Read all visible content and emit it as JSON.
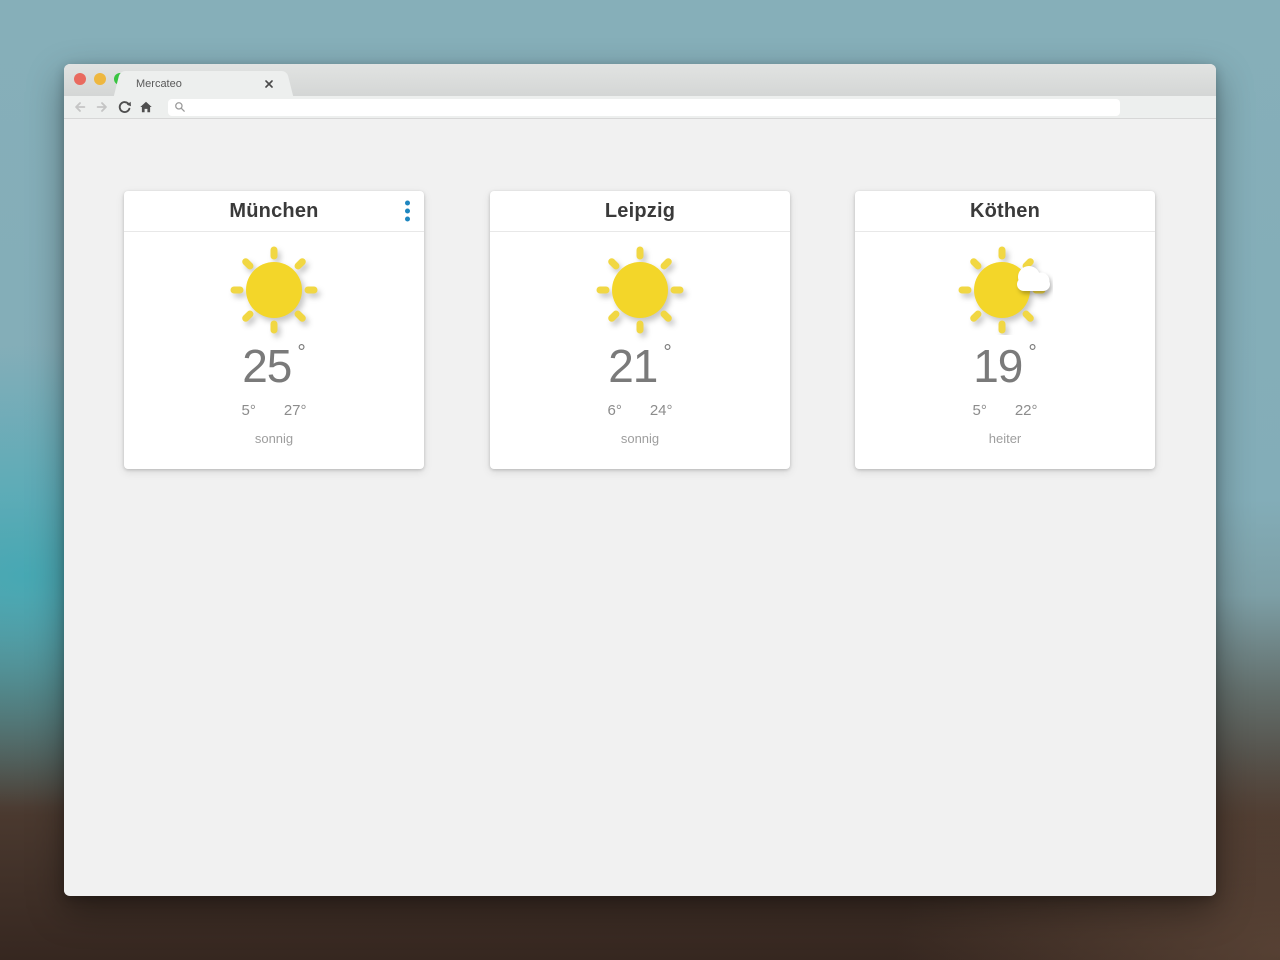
{
  "window": {
    "tab_title": "Mercateo"
  },
  "toolbar": {
    "url_value": "",
    "icons": [
      "back-icon",
      "forward-icon",
      "reload-icon",
      "home-icon",
      "search-icon"
    ]
  },
  "colors": {
    "accent_blue": "#1e86c0",
    "sun_yellow": "#f3d629",
    "content_background": "#f1f1f1",
    "traffic_red": "#e96a5f",
    "traffic_yellow": "#eeb73f",
    "traffic_green": "#38c440"
  },
  "cards": [
    {
      "city": "München",
      "temp": "25",
      "degree_symbol": "°",
      "low": "5°",
      "high": "27°",
      "condition": "sonnig",
      "icon": "sun-icon",
      "has_menu": true
    },
    {
      "city": "Leipzig",
      "temp": "21",
      "degree_symbol": "°",
      "low": "6°",
      "high": "24°",
      "condition": "sonnig",
      "icon": "sun-icon",
      "has_menu": false
    },
    {
      "city": "Köthen",
      "temp": "19",
      "degree_symbol": "°",
      "low": "5°",
      "high": "22°",
      "condition": "heiter",
      "icon": "sun-cloud-icon",
      "has_menu": false
    }
  ]
}
